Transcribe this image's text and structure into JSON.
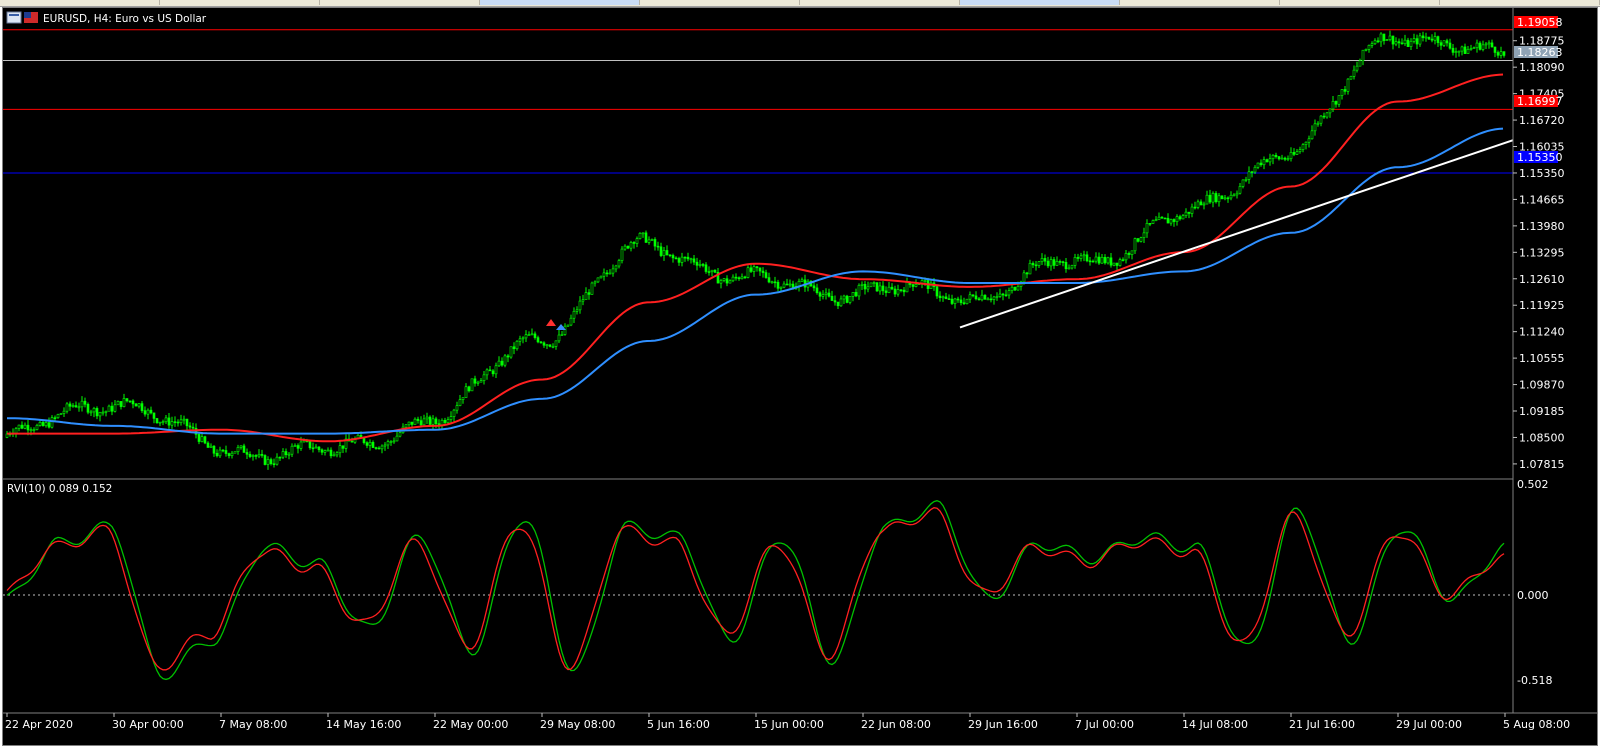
{
  "window": {
    "symbol_title": "EURUSD, H4:  Euro vs US Dollar"
  },
  "tabs": [
    {
      "active": false
    },
    {
      "active": false
    },
    {
      "active": false
    },
    {
      "active": true
    },
    {
      "active": false
    },
    {
      "active": false
    },
    {
      "active": true
    },
    {
      "active": false
    },
    {
      "active": false
    },
    {
      "active": false
    }
  ],
  "price_axis": {
    "ticks": [
      "1.18775",
      "1.18090",
      "1.17405",
      "1.16720",
      "1.16035",
      "1.15350",
      "1.14665",
      "1.13980",
      "1.13295",
      "1.12610",
      "1.11925",
      "1.11240",
      "1.10555",
      "1.09870",
      "1.09185",
      "1.08500",
      "1.07815"
    ],
    "badges": {
      "resistance_top": "1.19058",
      "current_price": "1.18263",
      "resistance_mid": "1.16997",
      "support_blue": "1.15350"
    }
  },
  "indicator": {
    "title": "RVI(10) 0.089 0.152",
    "axis_top": "0.502",
    "axis_zero": "0.000",
    "axis_bottom": "-0.518"
  },
  "time_axis": {
    "labels": [
      "22 Apr 2020",
      "30 Apr 00:00",
      "7 May 08:00",
      "14 May 16:00",
      "22 May 00:00",
      "29 May 08:00",
      "5 Jun 16:00",
      "15 Jun 00:00",
      "22 Jun 08:00",
      "29 Jun 16:00",
      "7 Jul 00:00",
      "14 Jul 08:00",
      "21 Jul 16:00",
      "29 Jul 00:00",
      "5 Aug 08:00"
    ]
  },
  "chart_data": {
    "type": "line",
    "title": "EURUSD, H4:  Euro vs US Dollar",
    "ylim": [
      1.0745,
      1.1926
    ],
    "x": [
      "22 Apr 2020",
      "30 Apr 00:00",
      "7 May 08:00",
      "14 May 16:00",
      "22 May 00:00",
      "29 May 08:00",
      "5 Jun 16:00",
      "15 Jun 00:00",
      "22 Jun 08:00",
      "29 Jun 16:00",
      "7 Jul 00:00",
      "14 Jul 08:00",
      "21 Jul 16:00",
      "29 Jul 00:00",
      "5 Aug 08:00"
    ],
    "series": [
      {
        "values": [
          1.085,
          1.095,
          1.082,
          1.081,
          1.09,
          1.112,
          1.135,
          1.125,
          1.123,
          1.122,
          1.13,
          1.142,
          1.16,
          1.19,
          1.183
        ],
        "color": "#00e000"
      },
      {
        "values": [
          1.086,
          1.086,
          1.087,
          1.084,
          1.088,
          1.1,
          1.12,
          1.13,
          1.126,
          1.124,
          1.126,
          1.133,
          1.15,
          1.172,
          1.179
        ],
        "color": "#ff2020"
      },
      {
        "values": [
          1.09,
          1.088,
          1.086,
          1.086,
          1.087,
          1.095,
          1.11,
          1.122,
          1.128,
          1.125,
          1.125,
          1.128,
          1.138,
          1.155,
          1.165
        ],
        "color": "#2f8fff"
      }
    ],
    "horizontal_lines": [
      {
        "value": 1.19058,
        "color": "#ff0000"
      },
      {
        "value": 1.18263,
        "color": "#c0c0c0"
      },
      {
        "value": 1.16997,
        "color": "#ff0000"
      },
      {
        "value": 1.1535,
        "color": "#0000ff"
      }
    ],
    "trendline": {
      "from": [
        "29 Jun 16:00",
        1.1135
      ],
      "to": [
        "5 Aug 08:00",
        1.162
      ],
      "color": "#ffffff"
    },
    "indicator_ylim": [
      -0.518,
      0.502
    ],
    "rvi_main": [
      -0.05,
      0.22,
      0.3,
      -0.42,
      -0.25,
      0.2,
      0.12,
      -0.2,
      0.25,
      -0.3,
      0.35,
      -0.4,
      0.3,
      0.25,
      -0.25,
      0.25,
      -0.35,
      0.3,
      0.4,
      -0.05,
      0.22,
      0.15,
      0.25,
      0.2,
      -0.3,
      0.38,
      -0.25,
      0.3,
      -0.05,
      0.2
    ],
    "rvi_signal": [
      -0.03,
      0.2,
      0.28,
      -0.38,
      -0.22,
      0.18,
      0.1,
      -0.18,
      0.22,
      -0.28,
      0.32,
      -0.38,
      0.28,
      0.22,
      -0.22,
      0.22,
      -0.32,
      0.28,
      0.37,
      -0.03,
      0.2,
      0.13,
      0.23,
      0.18,
      -0.28,
      0.35,
      -0.22,
      0.28,
      -0.03,
      0.15
    ]
  }
}
